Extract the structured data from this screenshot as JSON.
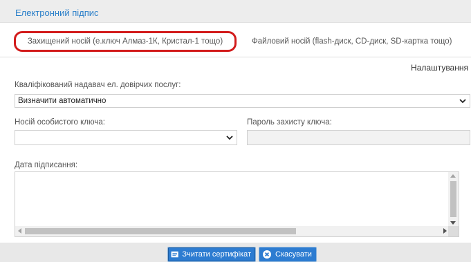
{
  "header": {
    "title": "Електронний підпис"
  },
  "tabs": [
    {
      "label": "Захищений носій (е.ключ Алмаз-1К, Кристал-1 тощо)",
      "active": true
    },
    {
      "label": "Файловий носій (flash-диск, CD-диск, SD-картка тощо)",
      "active": false
    }
  ],
  "settings_label": "Налаштування",
  "form": {
    "provider_label": "Кваліфікований надавач ел. довірчих послуг:",
    "provider_value": "Визначити автоматично",
    "key_media_label": "Носій особистого ключа:",
    "key_media_value": "",
    "password_label": "Пароль захисту ключа:",
    "password_value": "",
    "sign_date_label": "Дата підписання:"
  },
  "buttons": {
    "read_certificate": "Зчитати сертифікат",
    "cancel": "Скасувати"
  },
  "colors": {
    "accent": "#2a7fc9",
    "highlight": "#d21b1b",
    "button": "#2d7cd1"
  },
  "icons": {
    "read_certificate": "certificate-icon",
    "cancel": "cancel-circle-icon"
  }
}
